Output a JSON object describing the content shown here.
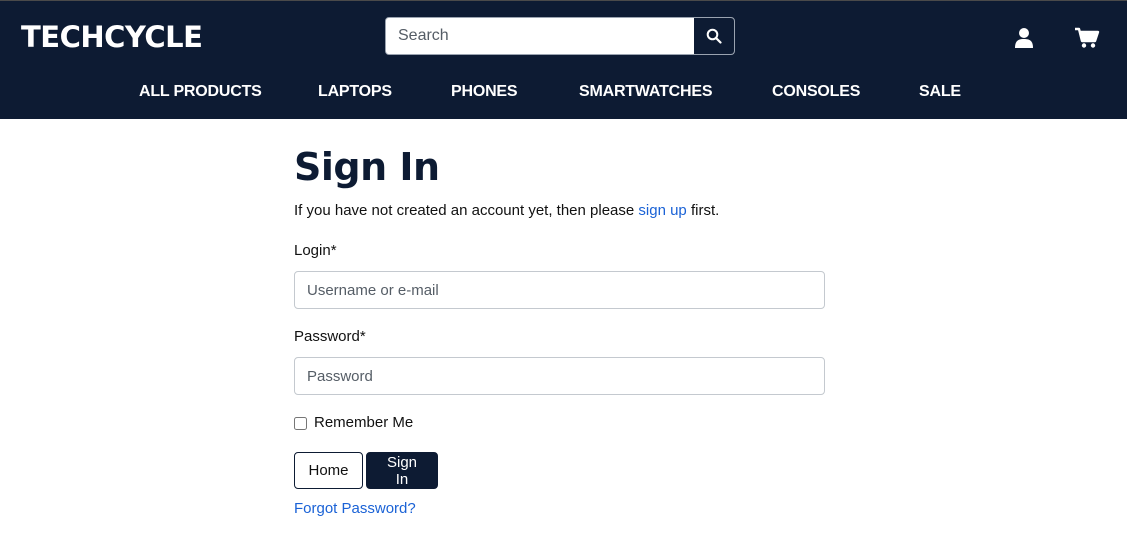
{
  "header": {
    "logo": "TECHCYCLE",
    "search": {
      "placeholder": "Search",
      "value": ""
    },
    "icons": {
      "search": "search-icon",
      "account": "user-icon",
      "cart": "cart-icon"
    }
  },
  "nav": {
    "items": [
      "ALL PRODUCTS",
      "LAPTOPS",
      "PHONES",
      "SMARTWATCHES",
      "CONSOLES",
      "SALE"
    ]
  },
  "signin": {
    "title": "Sign In",
    "intro_before": "If you have not created an account yet, then please ",
    "intro_link": "sign up",
    "intro_after": " first.",
    "login_label": "Login*",
    "login_placeholder": "Username or e-mail",
    "password_label": "Password*",
    "password_placeholder": "Password",
    "remember_label": "Remember Me",
    "remember_checked": false,
    "home_button": "Home",
    "signin_button": "Sign In",
    "forgot_link": "Forgot Password?"
  },
  "colors": {
    "brand_navy": "#0d1b33",
    "link": "#1a62d6"
  }
}
